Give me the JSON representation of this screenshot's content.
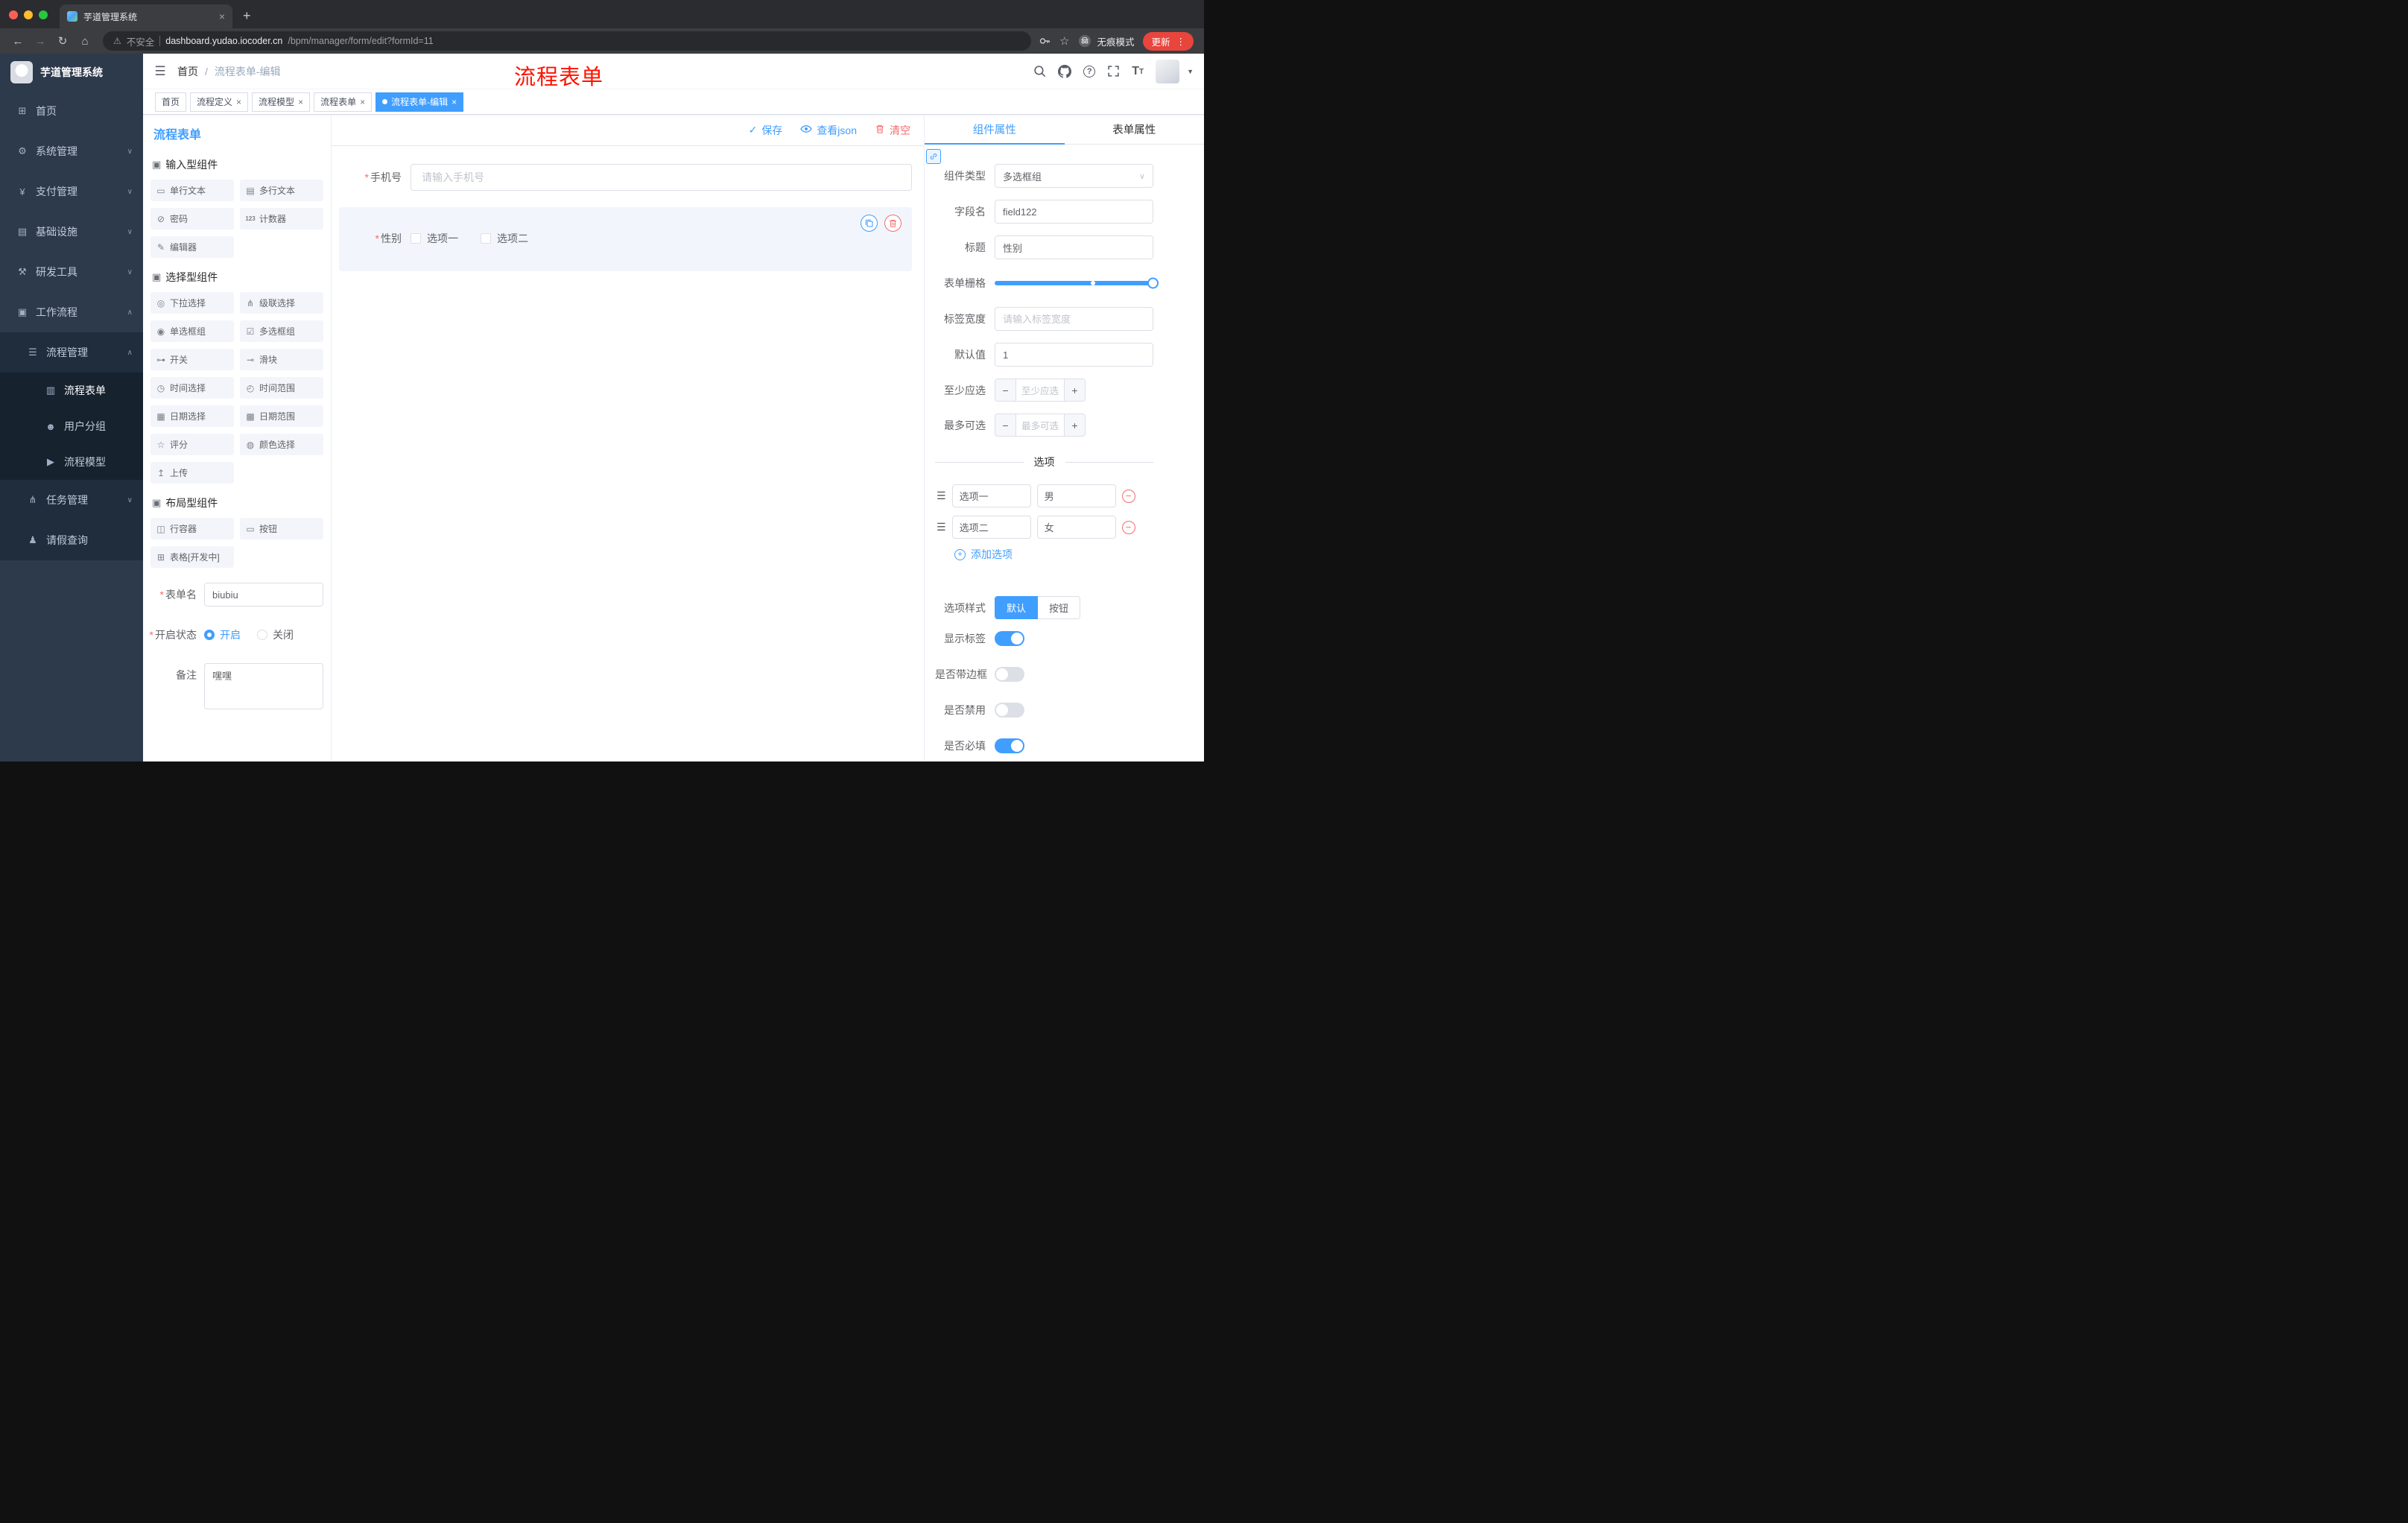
{
  "colors": {
    "primary": "#409eff",
    "danger": "#f56c6c",
    "sidebar_bg": "#2d3a4b",
    "submenu_bg": "#1f2d3d",
    "update_button": "#e8453c",
    "annotation": "#ff1100"
  },
  "glyphs": {
    "close": "×",
    "plus": "+",
    "hamburger": "☰",
    "check": "✓",
    "caret_down": "∨",
    "caret_up": "∧",
    "caret_solid": "▼",
    "back": "←",
    "forward": "→",
    "reload": "↻",
    "home": "⌂",
    "star": "☆",
    "kebab": "⋮",
    "warning": "⚠",
    "question": "?",
    "font_large": "T",
    "font_small": "T",
    "minus": "−",
    "drag": "☰",
    "required": "*",
    "section_box": "▣",
    "select_caret": "∨"
  },
  "chrome": {
    "tab_title": "芋道管理系统",
    "security": "不安全",
    "url_host": "dashboard.yudao.iocoder.cn",
    "url_path": "/bpm/manager/form/edit?formId=11",
    "incognito": "无痕模式",
    "update": "更新"
  },
  "sidebar": {
    "logo": "芋道管理系统",
    "menu": [
      {
        "label": "首页",
        "glyph": "⊞",
        "expand": ""
      },
      {
        "label": "系统管理",
        "glyph": "⚙",
        "expand": "∨"
      },
      {
        "label": "支付管理",
        "glyph": "¥",
        "expand": "∨"
      },
      {
        "label": "基础设施",
        "glyph": "▤",
        "expand": "∨"
      },
      {
        "label": "研发工具",
        "glyph": "⚒",
        "expand": "∨"
      },
      {
        "label": "工作流程",
        "glyph": "▣",
        "expand": "∧"
      }
    ],
    "submenu": [
      {
        "label": "流程管理",
        "glyph": "☰",
        "expand": "∧"
      },
      {
        "label": "流程表单",
        "glyph": "▥",
        "expand": ""
      },
      {
        "label": "用户分组",
        "glyph": "☻",
        "expand": ""
      },
      {
        "label": "流程模型",
        "glyph": "▶",
        "expand": ""
      },
      {
        "label": "任务管理",
        "glyph": "⋔",
        "expand": "∨"
      },
      {
        "label": "请假查询",
        "glyph": "♟",
        "expand": ""
      }
    ]
  },
  "header": {
    "breadcrumb_home": "首页",
    "breadcrumb_sep": "/",
    "breadcrumb_current": "流程表单-编辑",
    "annotation": "流程表单"
  },
  "tags": [
    {
      "label": "首页"
    },
    {
      "label": "流程定义"
    },
    {
      "label": "流程模型"
    },
    {
      "label": "流程表单"
    },
    {
      "label": "流程表单-编辑"
    }
  ],
  "designer": {
    "title": "流程表单",
    "save": "保存",
    "view_json": "查看json",
    "clear": "清空",
    "palette": {
      "sections": [
        {
          "title": "输入型组件",
          "items": [
            {
              "label": "单行文本",
              "glyph": "▭"
            },
            {
              "label": "多行文本",
              "glyph": "▤"
            },
            {
              "label": "密码",
              "glyph": "⊘"
            },
            {
              "label": "计数器",
              "glyph": "123"
            },
            {
              "label": "编辑器",
              "glyph": "✎"
            }
          ]
        },
        {
          "title": "选择型组件",
          "items": [
            {
              "label": "下拉选择",
              "glyph": "◎"
            },
            {
              "label": "级联选择",
              "glyph": "⋔"
            },
            {
              "label": "单选框组",
              "glyph": "◉"
            },
            {
              "label": "多选框组",
              "glyph": "☑"
            },
            {
              "label": "开关",
              "glyph": "⊶"
            },
            {
              "label": "滑块",
              "glyph": "⊸"
            },
            {
              "label": "时间选择",
              "glyph": "◷"
            },
            {
              "label": "时间范围",
              "glyph": "◴"
            },
            {
              "label": "日期选择",
              "glyph": "▦"
            },
            {
              "label": "日期范围",
              "glyph": "▩"
            },
            {
              "label": "评分",
              "glyph": "☆"
            },
            {
              "label": "颜色选择",
              "glyph": "◍"
            },
            {
              "label": "上传",
              "glyph": "↥"
            }
          ]
        },
        {
          "title": "布局型组件",
          "items": [
            {
              "label": "行容器",
              "glyph": "◫"
            },
            {
              "label": "按钮",
              "glyph": "▭"
            },
            {
              "label": "表格[开发中]",
              "glyph": "⊞"
            }
          ]
        }
      ]
    },
    "settings": {
      "form_name_label": "表单名",
      "form_name_value": "biubiu",
      "status_label": "开启状态",
      "status_on": "开启",
      "status_off": "关闭",
      "remark_label": "备注",
      "remark_value": "嘿嘿"
    },
    "canvas": {
      "phone_label": "手机号",
      "phone_placeholder": "请输入手机号",
      "gender_label": "性别",
      "gender_opt1": "选项一",
      "gender_opt2": "选项二"
    }
  },
  "props": {
    "tab_component": "组件属性",
    "tab_form": "表单属性",
    "component_type_label": "组件类型",
    "component_type_value": "多选框组",
    "field_name_label": "字段名",
    "field_name_value": "field122",
    "title_label": "标题",
    "title_value": "性别",
    "grid_label": "表单栅格",
    "label_width_label": "标签宽度",
    "label_width_placeholder": "请输入标签宽度",
    "default_label": "默认值",
    "default_value": "1",
    "min_label": "至少应选",
    "min_placeholder": "至少应选",
    "max_label": "最多可选",
    "max_placeholder": "最多可选",
    "divider": "选项",
    "options": [
      {
        "name": "选项一",
        "value": "男"
      },
      {
        "name": "选项二",
        "value": "女"
      }
    ],
    "add_option": "添加选项",
    "style_label": "选项样式",
    "style_default": "默认",
    "style_button": "按钮",
    "switches": [
      {
        "label": "显示标签",
        "on": true
      },
      {
        "label": "是否带边框",
        "on": false
      },
      {
        "label": "是否禁用",
        "on": false
      },
      {
        "label": "是否必填",
        "on": true
      }
    ]
  }
}
